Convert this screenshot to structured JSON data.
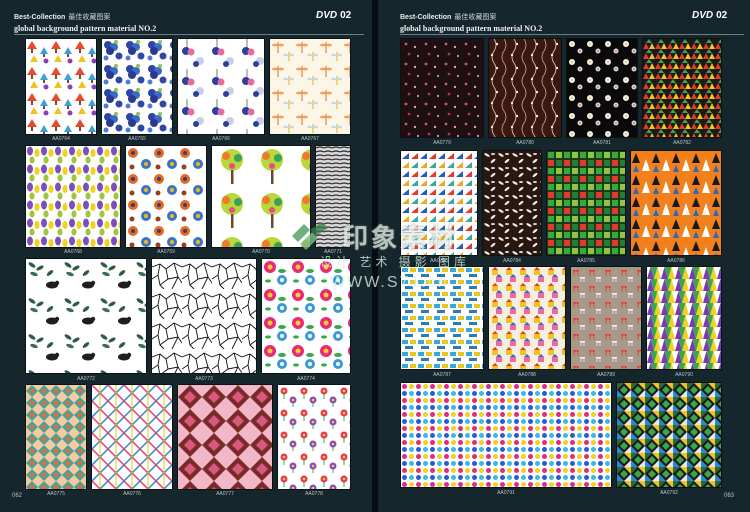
{
  "left_page": {
    "brand": "Best-Collection",
    "brand_cn": "最佳收藏图案",
    "dvd_label": "DVD",
    "dvd_number": "02",
    "subtitle": "global background pattern material NO.2",
    "page_number": "062",
    "codes": [
      "AA0764",
      "AA0765",
      "AA0766",
      "AA0767",
      "AA0768",
      "AA0769",
      "AA0770",
      "AA0771",
      "AA0772",
      "AA0773",
      "AA0774",
      "AA0775",
      "AA0776",
      "AA0777",
      "AA0778"
    ]
  },
  "right_page": {
    "brand": "Best-Collection",
    "brand_cn": "最佳收藏图案",
    "dvd_label": "DVD",
    "dvd_number": "02",
    "subtitle": "global background pattern material NO.2",
    "page_number": "063",
    "codes": [
      "AA0779",
      "AA0780",
      "AA0781",
      "AA0782",
      "AA0783",
      "AA0784",
      "AA0785",
      "AA0786",
      "AA0787",
      "AA0788",
      "AA0789",
      "AA0790",
      "AA0791",
      "AA0792"
    ]
  },
  "watermark": {
    "title_cn": "印象素材",
    "subtitle_cn": "设计 艺术 摄影 图库",
    "url": "WWW.S71.cn",
    "logo_icon": "leaf-logo-icon"
  },
  "colors": {
    "background": "#16262d",
    "accent_green": "#3a7d4a"
  }
}
